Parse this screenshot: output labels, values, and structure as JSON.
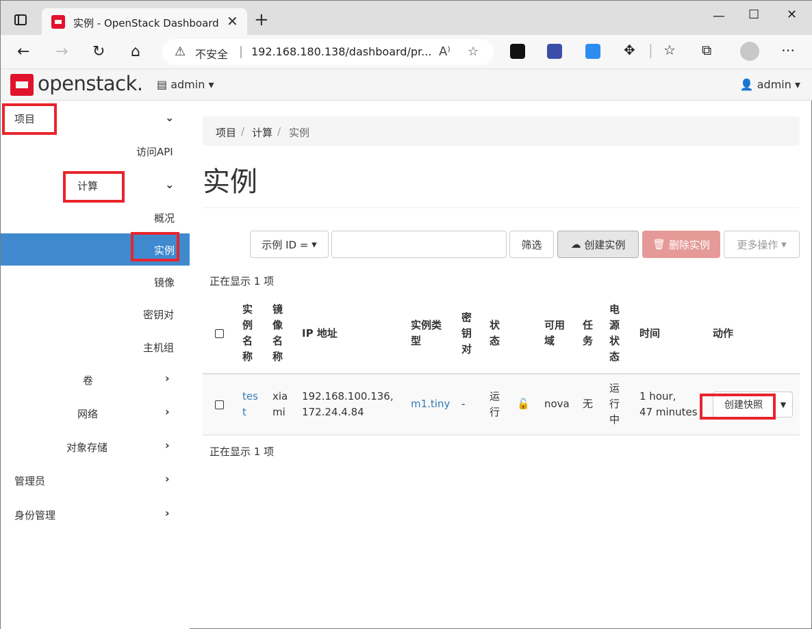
{
  "browser": {
    "tab_title": "实例 - OpenStack Dashboard",
    "security_label": "不安全",
    "url": "192.168.180.138/dashboard/pr...",
    "read_aloud": "A⁾"
  },
  "header": {
    "logo_text": "openstack.",
    "project_selector": "admin",
    "user_menu": "admin"
  },
  "sidebar": {
    "project": "项目",
    "access_api": "访问API",
    "compute": "计算",
    "overview": "概况",
    "instances": "实例",
    "images": "镜像",
    "keypairs": "密钥对",
    "server_groups": "主机组",
    "volumes": "卷",
    "network": "网络",
    "object_store": "对象存储",
    "admin": "管理员",
    "identity": "身份管理"
  },
  "breadcrumb": [
    "项目",
    "计算",
    "实例"
  ],
  "page_title": "实例",
  "toolbar": {
    "filter_field": "示例 ID =",
    "filter_input_value": "",
    "filter_button": "筛选",
    "launch_button": "创建实例",
    "delete_button": "删除实例",
    "more_actions": "更多操作"
  },
  "count_label": "正在显示 1 项",
  "table": {
    "headers": {
      "name": "实例名称",
      "image": "镜像名称",
      "ip": "IP 地址",
      "flavor": "实例类型",
      "keypair": "密钥对",
      "status": "状态",
      "az": "可用域",
      "task": "任务",
      "power": "电源状态",
      "age": "时间",
      "actions": "动作"
    },
    "rows": [
      {
        "name_1": "tes",
        "name_2": "t",
        "image_1": "xia",
        "image_2": "mi",
        "ip_1": "192.168.100.136,",
        "ip_2": "172.24.4.84",
        "flavor": "m1.tiny",
        "keypair": "-",
        "status_1": "运",
        "status_2": "行",
        "az": "nova",
        "task": "无",
        "power_1": "运",
        "power_2": "行",
        "power_3": "中",
        "age_1": "1 hour,",
        "age_2": "47 minutes",
        "action": "创建快照"
      }
    ]
  },
  "colors": {
    "active_nav": "#3f8ace",
    "danger": "#e59a97",
    "link": "#337ab7",
    "highlight_box": "#e8242c",
    "brand": "#e0122c"
  }
}
